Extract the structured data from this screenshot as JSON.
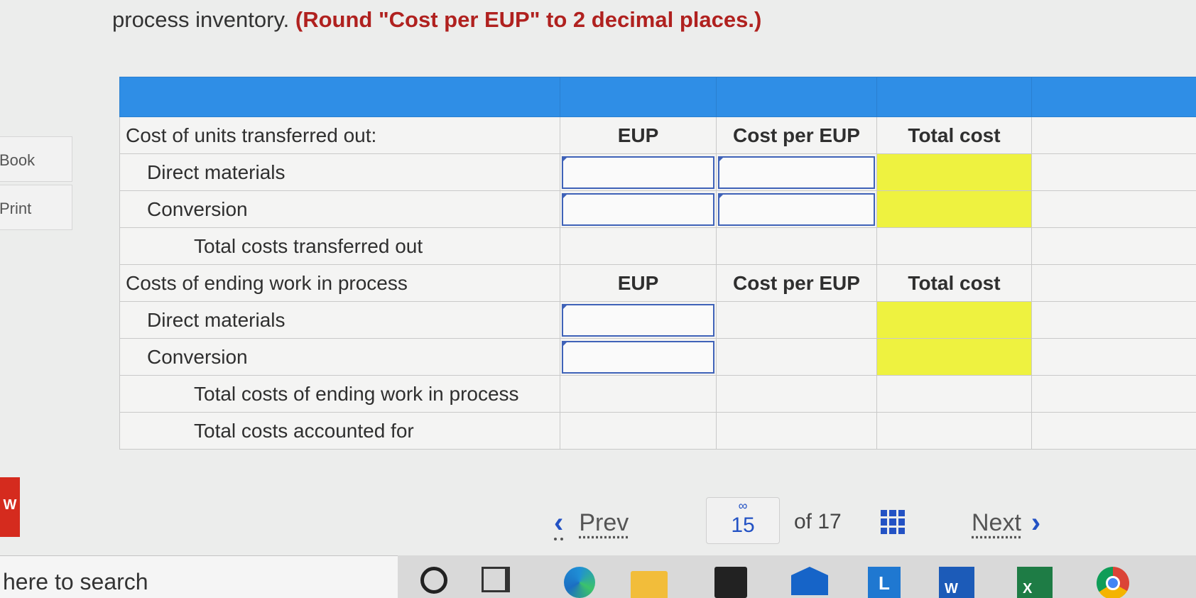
{
  "instruction": {
    "plain": "process inventory. ",
    "emphasis": "(Round \"Cost per EUP\" to 2 decimal places.)"
  },
  "sidebar": {
    "book_label": "Book",
    "print_label": "Print"
  },
  "brand": {
    "logo_letter": "W"
  },
  "table": {
    "section1": {
      "title": "Cost of units transferred out:",
      "col_eup": "EUP",
      "col_cost_per_eup": "Cost per EUP",
      "col_total_cost": "Total cost",
      "row_direct_materials": "Direct materials",
      "row_conversion": "Conversion",
      "row_total": "Total costs transferred out"
    },
    "section2": {
      "title": "Costs of ending work in process",
      "col_eup": "EUP",
      "col_cost_per_eup": "Cost per EUP",
      "col_total_cost": "Total cost",
      "row_direct_materials": "Direct materials",
      "row_conversion": "Conversion",
      "row_total": "Total costs of ending work in process"
    },
    "grand_total": "Total costs accounted for",
    "input_values": {
      "s1_dm_eup": "",
      "s1_dm_cpe": "",
      "s1_conv_eup": "",
      "s1_conv_cpe": "",
      "s2_dm_eup": "",
      "s2_conv_eup": ""
    }
  },
  "pager": {
    "prev_label": "Prev",
    "current_page": "15",
    "of_total": "of 17",
    "next_label": "Next"
  },
  "taskbar": {
    "search_text": "here to search",
    "word_letter": "W",
    "excel_letter": "X",
    "lync_letter": "L"
  },
  "colors": {
    "header_band": "#2f8ee6",
    "highlight_yellow": "#eef240",
    "emphasis_red": "#b0211f",
    "link_blue": "#2352c4",
    "input_border": "#3f62b8"
  },
  "icons": [
    "link-icon",
    "grid-icon",
    "chevron-left-icon",
    "chevron-right-icon",
    "cortana-icon",
    "task-view-icon",
    "edge-icon",
    "file-explorer-icon",
    "store-icon",
    "mail-icon",
    "lync-icon",
    "word-icon",
    "excel-icon",
    "chrome-icon"
  ]
}
